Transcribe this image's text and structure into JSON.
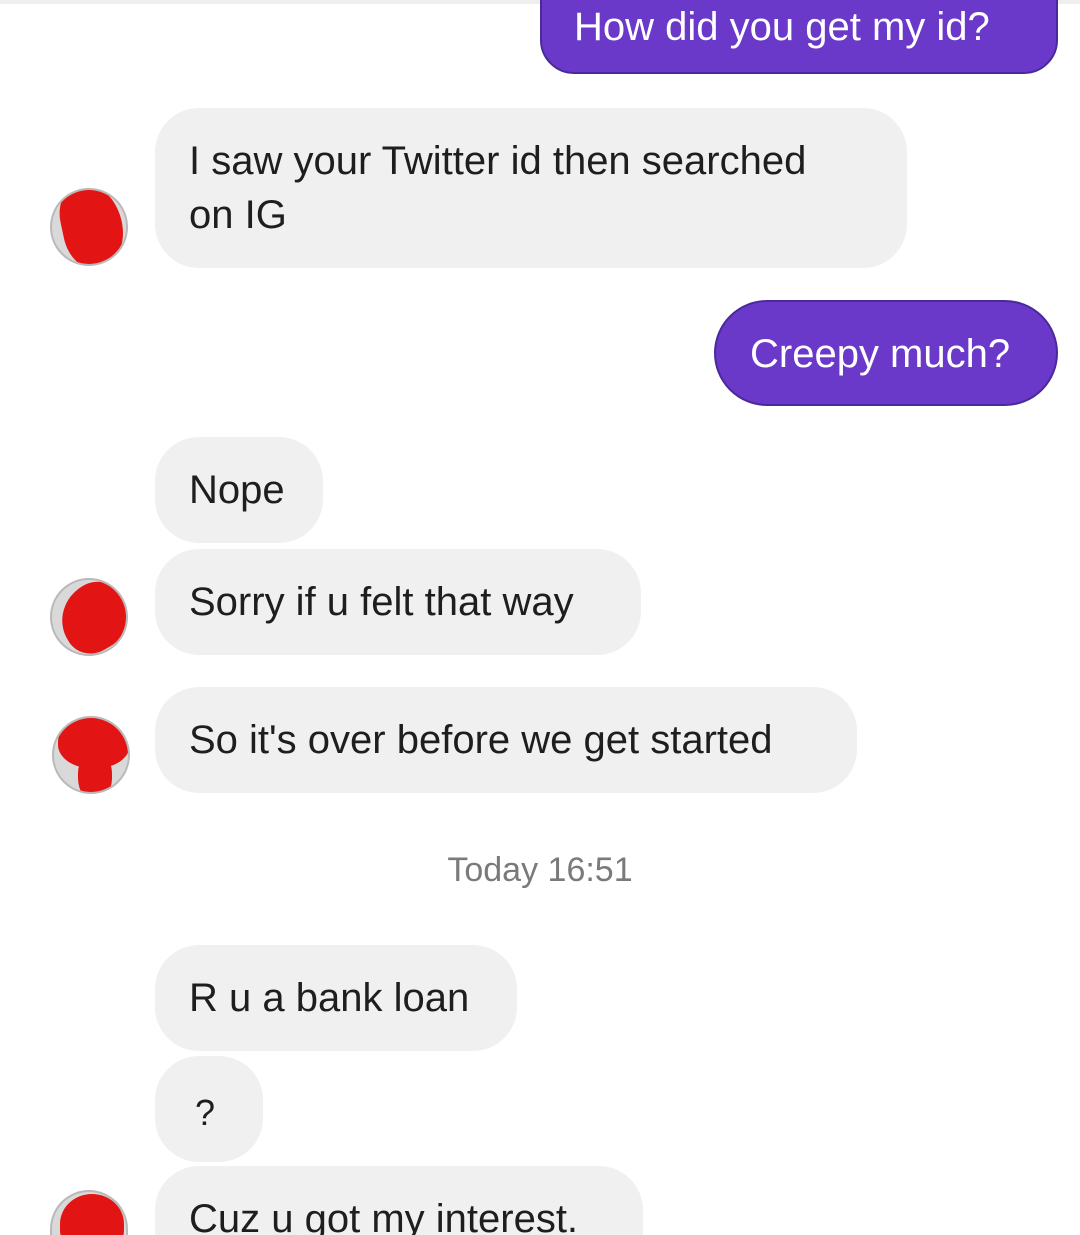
{
  "thread": {
    "messages": [
      {
        "direction": "outgoing",
        "text": "How did you get my id?"
      },
      {
        "direction": "incoming",
        "text_line1": "I saw your Twitter id then searched",
        "text_line2": "on IG"
      },
      {
        "direction": "outgoing",
        "text": "Creepy much?"
      },
      {
        "direction": "incoming",
        "text": "Nope"
      },
      {
        "direction": "incoming",
        "text": "Sorry if u felt that way"
      },
      {
        "direction": "incoming",
        "text": "So it's over before we get started"
      },
      {
        "direction": "incoming",
        "text": "R u a bank loan"
      },
      {
        "direction": "incoming",
        "text": "?"
      },
      {
        "direction": "incoming",
        "text": "Cuz u got my interest."
      }
    ],
    "timestamp": "Today 16:51"
  },
  "colors": {
    "outgoing_bubble": "#6a39c9",
    "incoming_bubble": "#f0f0f0",
    "avatar_redaction": "#e21414"
  },
  "icons": [
    "avatar"
  ]
}
